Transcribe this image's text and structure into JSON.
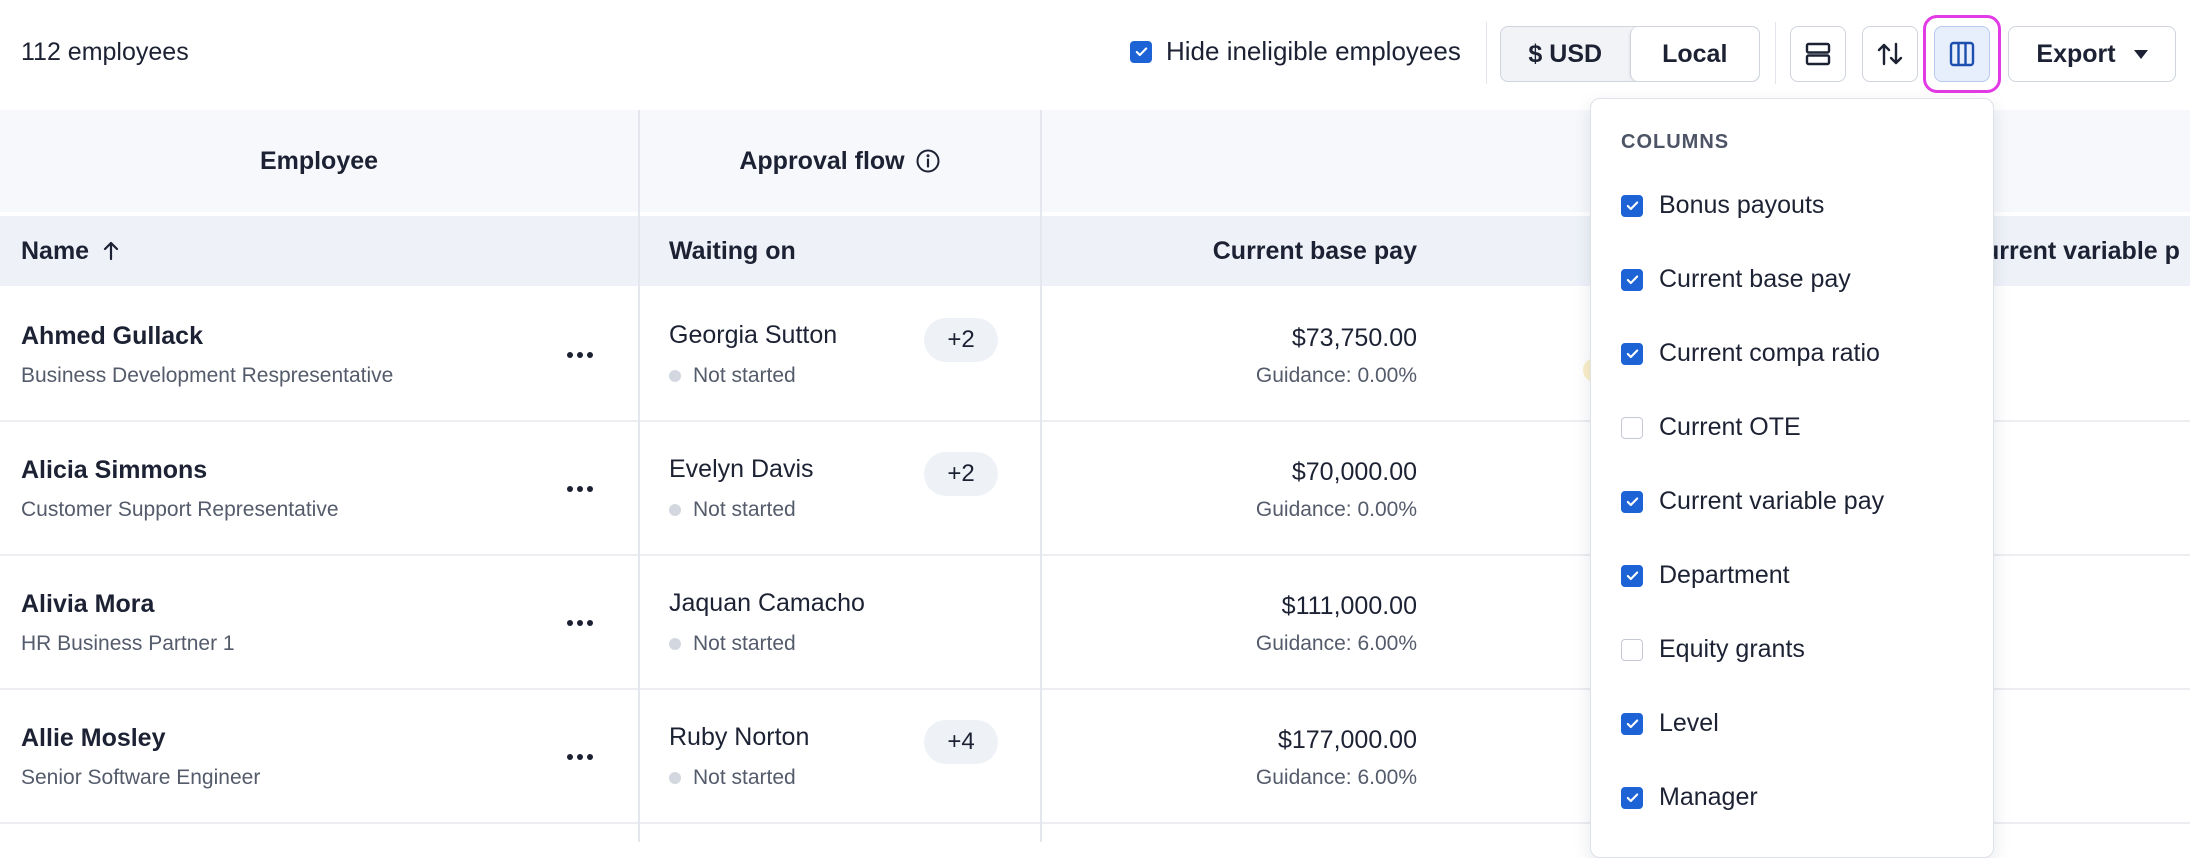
{
  "toolbar": {
    "employee_count": "112 employees",
    "hide_ineligible_label": "Hide ineligible employees",
    "hide_ineligible_checked": true,
    "currency_usd": "$ USD",
    "currency_local": "Local",
    "export_label": "Export"
  },
  "table": {
    "groups": {
      "employee": "Employee",
      "approval_flow": "Approval flow"
    },
    "headers": {
      "name": "Name",
      "waiting_on": "Waiting on",
      "current_base_pay": "Current base pay",
      "current_variable_pay": "urrent variable p"
    },
    "rows": [
      {
        "name": "Ahmed Gullack",
        "title": "Business Development Respresentative",
        "waiting_on": "Georgia Sutton",
        "status": "Not started",
        "extra": "+2",
        "base_pay": "$73,750.00",
        "guidance": "Guidance: 0.00%"
      },
      {
        "name": "Alicia Simmons",
        "title": "Customer Support Representative",
        "waiting_on": "Evelyn Davis",
        "status": "Not started",
        "extra": "+2",
        "base_pay": "$70,000.00",
        "guidance": "Guidance: 0.00%"
      },
      {
        "name": "Alivia Mora",
        "title": "HR Business Partner 1",
        "waiting_on": "Jaquan Camacho",
        "status": "Not started",
        "extra": "",
        "base_pay": "$111,000.00",
        "guidance": "Guidance: 6.00%"
      },
      {
        "name": "Allie Mosley",
        "title": "Senior Software Engineer",
        "waiting_on": "Ruby Norton",
        "status": "Not started",
        "extra": "+4",
        "base_pay": "$177,000.00",
        "guidance": "Guidance: 6.00%"
      }
    ]
  },
  "columns_menu": {
    "title": "COLUMNS",
    "items": [
      {
        "label": "Bonus payouts",
        "checked": true
      },
      {
        "label": "Current base pay",
        "checked": true
      },
      {
        "label": "Current compa ratio",
        "checked": true
      },
      {
        "label": "Current OTE",
        "checked": false
      },
      {
        "label": "Current variable pay",
        "checked": true
      },
      {
        "label": "Department",
        "checked": true
      },
      {
        "label": "Equity grants",
        "checked": false
      },
      {
        "label": "Level",
        "checked": true
      },
      {
        "label": "Manager",
        "checked": true
      }
    ]
  },
  "colors": {
    "accent": "#1d63d6",
    "focus_ring": "#e23be6",
    "header_bg": "#eef2f8"
  },
  "icons": {
    "check": "checkmark-icon",
    "row_density": "row-density-icon",
    "sort": "sort-icon",
    "columns": "columns-icon",
    "info": "info-icon",
    "more": "more-horizontal-icon",
    "sort_asc": "arrow-up-icon"
  }
}
